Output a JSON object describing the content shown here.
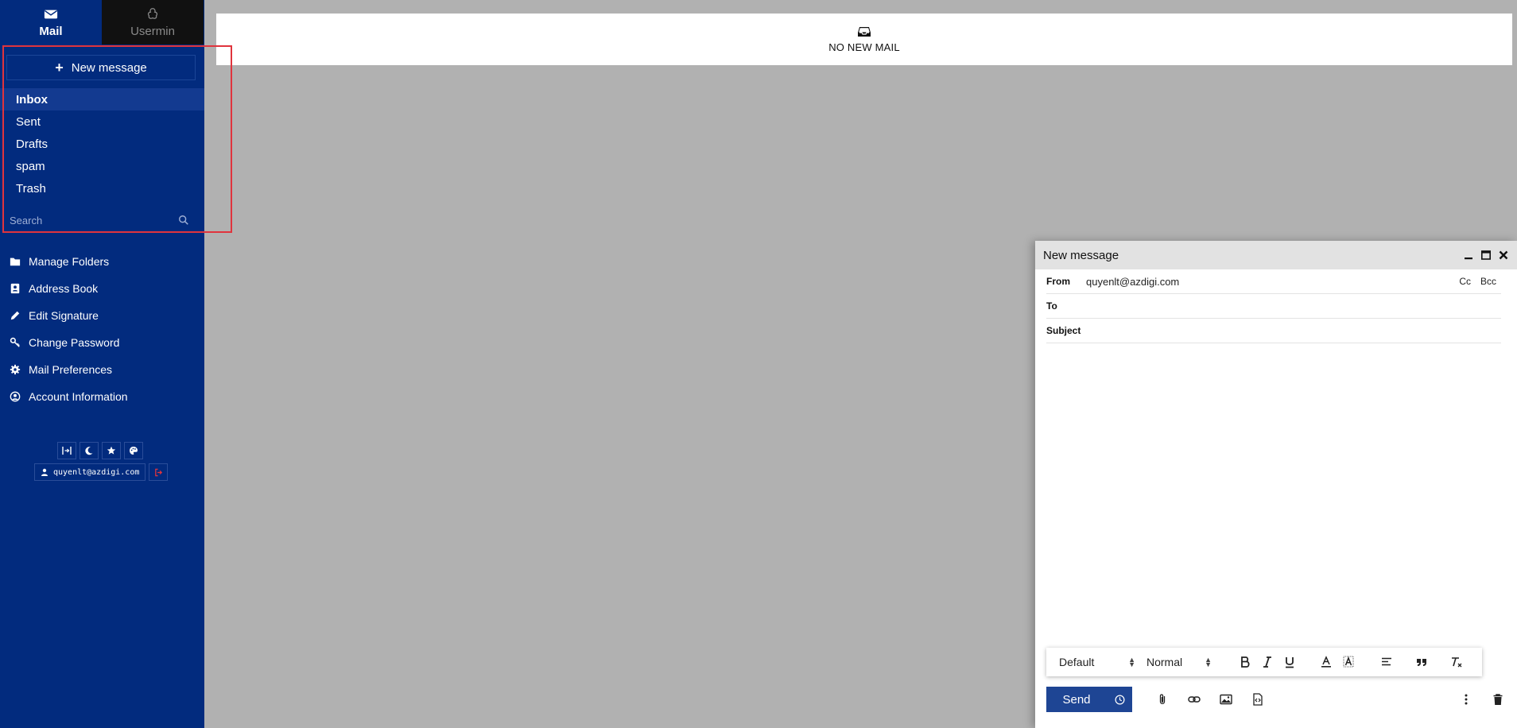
{
  "sidebar": {
    "tabs": [
      {
        "label": "Mail",
        "icon": "envelope-icon"
      },
      {
        "label": "Usermin",
        "icon": "usermin-logo-icon"
      }
    ],
    "new_message_label": "New message",
    "folders": [
      "Inbox",
      "Sent",
      "Drafts",
      "spam",
      "Trash"
    ],
    "search_placeholder": "Search",
    "menu": [
      {
        "label": "Manage Folders",
        "icon": "folder-icon"
      },
      {
        "label": "Address Book",
        "icon": "address-book-icon"
      },
      {
        "label": "Edit Signature",
        "icon": "pencil-icon"
      },
      {
        "label": "Change Password",
        "icon": "key-icon"
      },
      {
        "label": "Mail Preferences",
        "icon": "gear-icon"
      },
      {
        "label": "Account Information",
        "icon": "user-circle-icon"
      }
    ],
    "user_email": "quyenlt@azdigi.com"
  },
  "main": {
    "banner_text": "NO NEW MAIL"
  },
  "compose": {
    "title": "New message",
    "from_label": "From",
    "from_value": "quyenlt@azdigi.com",
    "cc_label": "Cc",
    "bcc_label": "Bcc",
    "to_label": "To",
    "subject_label": "Subject",
    "font_select": "Default",
    "size_select": "Normal",
    "send_label": "Send"
  },
  "colors": {
    "sidebar_bg": "#022b7e",
    "send_bg": "#1e4594",
    "highlight_border": "#e0343d"
  }
}
